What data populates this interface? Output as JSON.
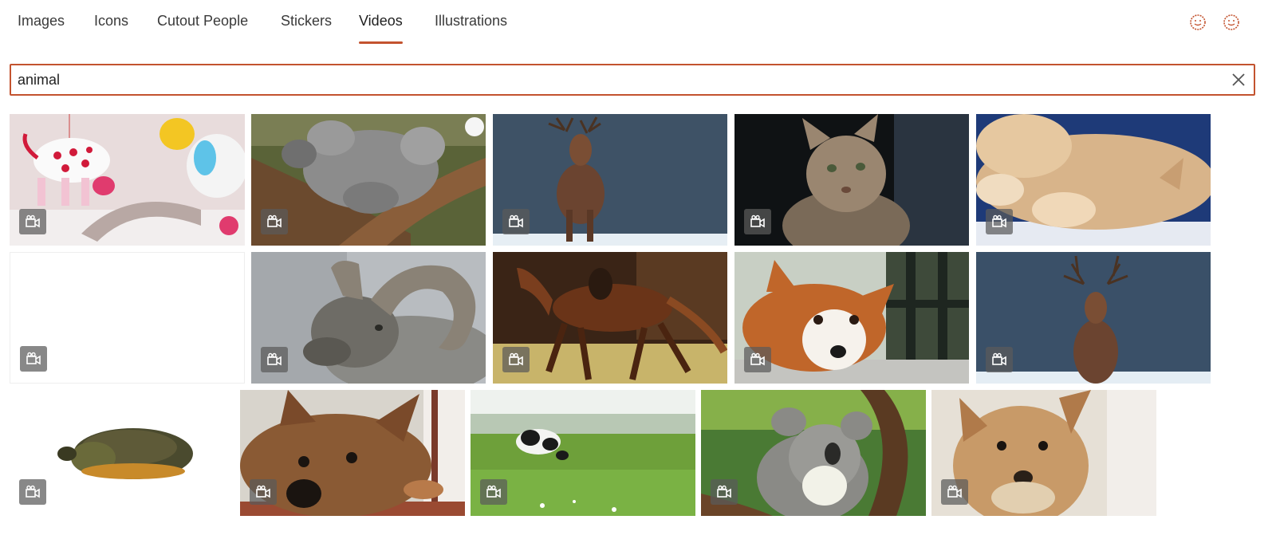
{
  "tabs": [
    {
      "label": "Images"
    },
    {
      "label": "Icons"
    },
    {
      "label": "Cutout People"
    },
    {
      "label": "Stickers"
    },
    {
      "label": "Videos",
      "active": true
    },
    {
      "label": "Illustrations"
    }
  ],
  "accent_color": "#c3532f",
  "top_icons": [
    "smiley-face-icon",
    "smiley-face-icon"
  ],
  "search": {
    "value": "animal"
  },
  "results": [
    {
      "subject": "toy animals mobile",
      "badge": "video-camera-icon"
    },
    {
      "subject": "koala on branch",
      "badge": "video-camera-icon"
    },
    {
      "subject": "deer in snow",
      "badge": "video-camera-icon"
    },
    {
      "subject": "tabby cat",
      "badge": "video-camera-icon"
    },
    {
      "subject": "fluffy cat lying",
      "badge": "video-camera-icon"
    },
    {
      "subject": "blank",
      "badge": "video-camera-icon"
    },
    {
      "subject": "bighorn ram",
      "badge": "video-camera-icon"
    },
    {
      "subject": "galloping horse",
      "badge": "video-camera-icon"
    },
    {
      "subject": "corgi lying down",
      "badge": "video-camera-icon"
    },
    {
      "subject": "deer in snow",
      "badge": "video-camera-icon"
    },
    {
      "subject": "turtle",
      "badge": "video-camera-icon"
    },
    {
      "subject": "terrier close-up",
      "badge": "video-camera-icon"
    },
    {
      "subject": "cow in meadow",
      "badge": "video-camera-icon"
    },
    {
      "subject": "koala in tree",
      "badge": "video-camera-icon"
    },
    {
      "subject": "scruffy dog",
      "badge": "video-camera-icon"
    }
  ]
}
